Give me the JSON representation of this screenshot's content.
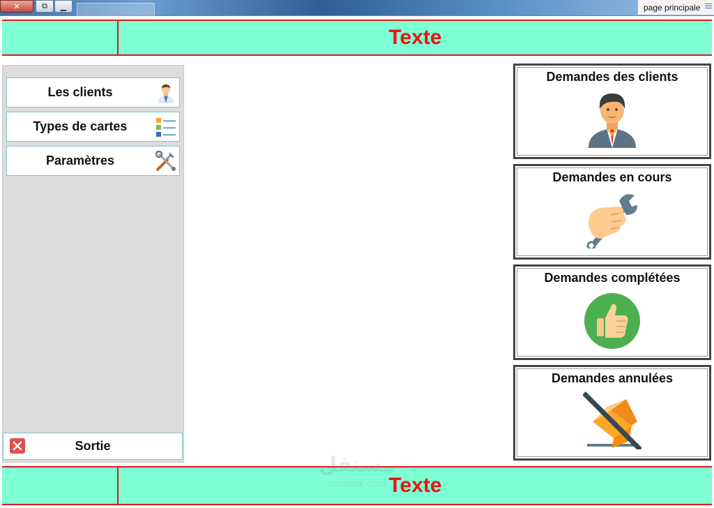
{
  "window": {
    "close_glyph": "✕",
    "restore_glyph": "⧉",
    "minimize_glyph": "▁",
    "tab_label": "page principale"
  },
  "header": {
    "title": "Texte"
  },
  "footer": {
    "title": "Texte"
  },
  "sidebar": {
    "items": [
      {
        "label": "Les clients",
        "icon": "businessman-icon"
      },
      {
        "label": "Types de cartes",
        "icon": "card-list-icon"
      },
      {
        "label": "Paramètres",
        "icon": "tools-icon"
      }
    ],
    "exit": {
      "label": "Sortie",
      "icon": "close-icon"
    }
  },
  "cards": [
    {
      "label": "Demandes des clients",
      "icon": "businessman-icon"
    },
    {
      "label": "Demandes en cours",
      "icon": "hand-wrench-icon"
    },
    {
      "label": "Demandes complétées",
      "icon": "thumbs-up-icon"
    },
    {
      "label": "Demandes annulées",
      "icon": "cancelled-box-icon"
    }
  ],
  "watermark": {
    "main": "مستقل",
    "sub": "mostaql.com"
  },
  "colors": {
    "band_bg": "#7fffd4",
    "band_border": "#e0191f",
    "title_text": "#ee1111",
    "sidebar_bg": "#dcdcdc",
    "button_border": "#78c8c8"
  }
}
